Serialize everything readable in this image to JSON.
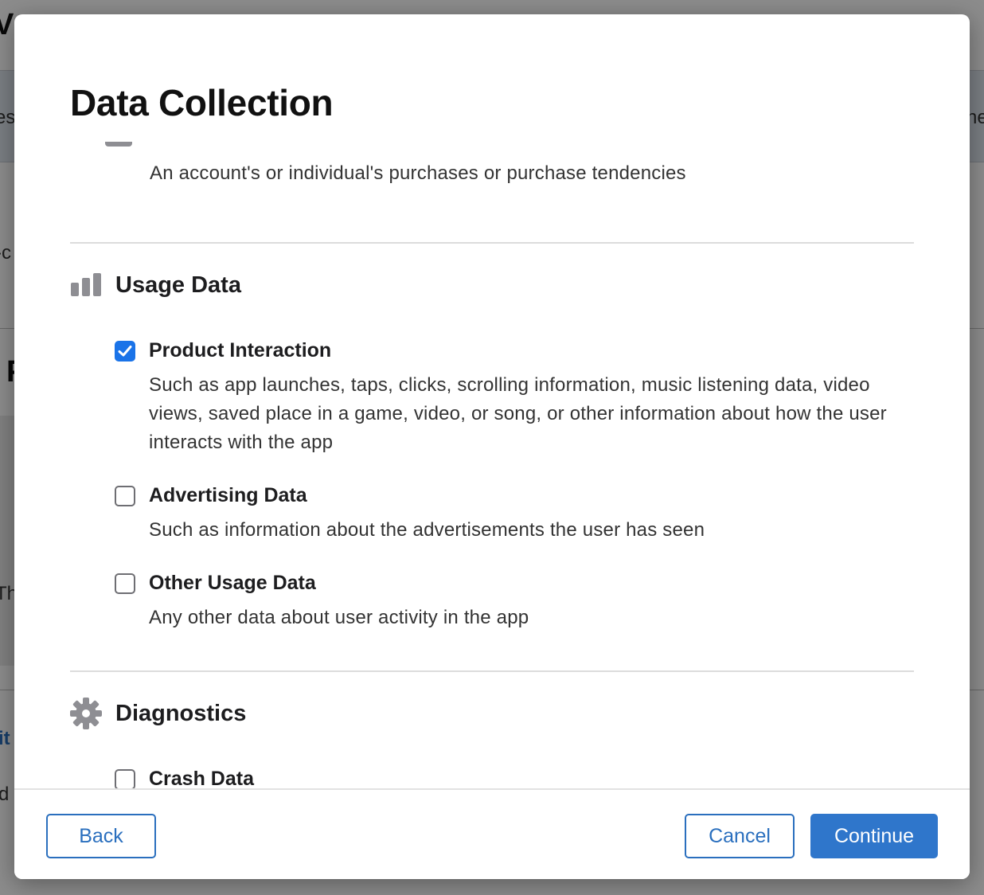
{
  "background": {
    "fragments": [
      "V",
      "es",
      "he",
      "-c",
      "P",
      "Th",
      "it",
      "d"
    ]
  },
  "dialog": {
    "title": "Data Collection",
    "previous_item_description": "An account's or individual's purchases or purchase tendencies",
    "sections": [
      {
        "label": "Usage Data",
        "icon": "bar-chart-icon",
        "options": [
          {
            "title": "Product Interaction",
            "checked": true,
            "description": "Such as app launches, taps, clicks, scrolling information, music listening data, video views, saved place in a game, video, or song, or other information about how the user interacts with the app"
          },
          {
            "title": "Advertising Data",
            "checked": false,
            "description": "Such as information about the advertisements the user has seen"
          },
          {
            "title": "Other Usage Data",
            "checked": false,
            "description": "Any other data about user activity in the app"
          }
        ]
      },
      {
        "label": "Diagnostics",
        "icon": "gear-icon",
        "options": [
          {
            "title": "Crash Data",
            "checked": false
          }
        ]
      }
    ],
    "footer": {
      "back_label": "Back",
      "cancel_label": "Cancel",
      "continue_label": "Continue"
    }
  },
  "colors": {
    "accent": "#2f76cb",
    "checkbox_checked": "#1a73e8",
    "icon_gray": "#8e8e93"
  }
}
